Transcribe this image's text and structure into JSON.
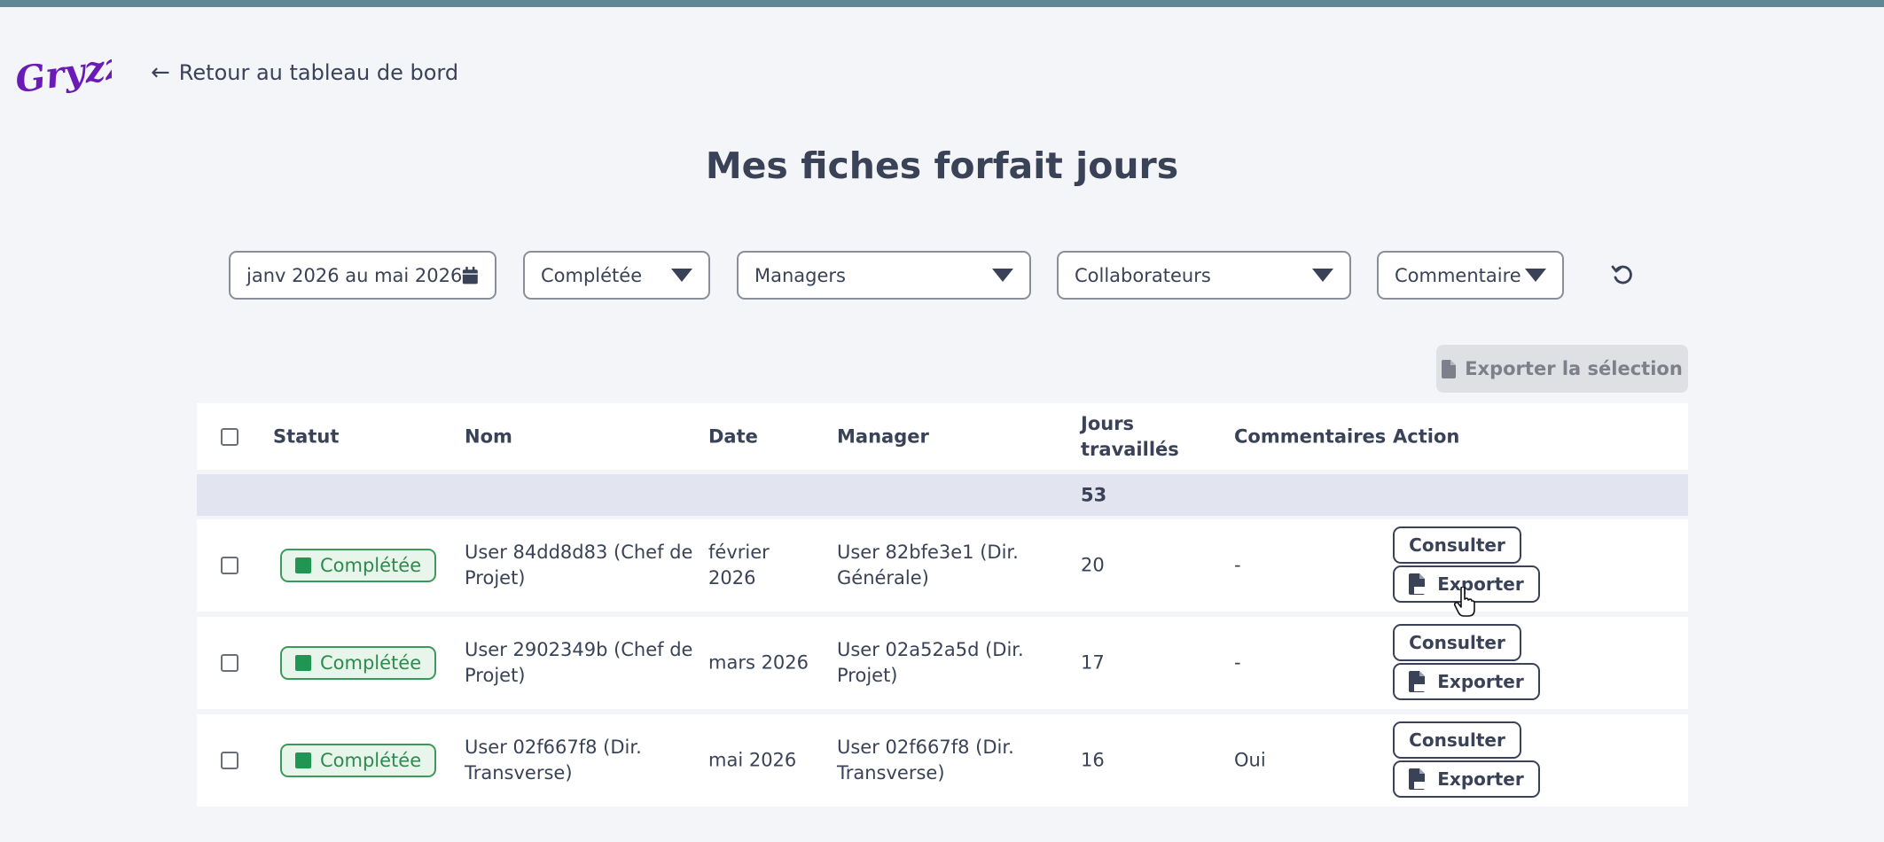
{
  "brand": {
    "logo_text": "Gryzzly",
    "logo_color": "#6b1bb5"
  },
  "nav": {
    "back_label": "Retour au tableau de bord"
  },
  "page": {
    "title": "Mes fiches forfait jours"
  },
  "filters": {
    "date_range": "janv 2026 au mai 2026",
    "status": "Complétée",
    "managers": "Managers",
    "collaborators": "Collaborateurs",
    "comment": "Commentaire"
  },
  "toolbar": {
    "export_selection": "Exporter la sélection"
  },
  "table": {
    "headers": {
      "status": "Statut",
      "name": "Nom",
      "date": "Date",
      "manager": "Manager",
      "days_line1": "Jours",
      "days_line2": "travaillés",
      "comments": "Commentaires",
      "action": "Action"
    },
    "total_days": "53",
    "rows": [
      {
        "status": "Complétée",
        "name_line1": "User 84dd8d83 (Chef de",
        "name_line2": "Projet)",
        "date_line1": "février",
        "date_line2": "2026",
        "manager_line1": "User 82bfe3e1 (Dir.",
        "manager_line2": "Générale)",
        "days": "20",
        "comment": "-"
      },
      {
        "status": "Complétée",
        "name_line1": "User 2902349b (Chef de",
        "name_line2": "Projet)",
        "date_line1": "mars 2026",
        "date_line2": "",
        "manager_line1": "User 02a52a5d (Dir.",
        "manager_line2": "Projet)",
        "days": "17",
        "comment": "-"
      },
      {
        "status": "Complétée",
        "name_line1": "User 02f667f8 (Dir.",
        "name_line2": "Transverse)",
        "date_line1": "mai 2026",
        "date_line2": "",
        "manager_line1": "User 02f667f8 (Dir.",
        "manager_line2": "Transverse)",
        "days": "16",
        "comment": "Oui"
      }
    ],
    "actions": {
      "consult": "Consulter",
      "export": "Exporter"
    }
  },
  "icons": {
    "back": "arrow-left-icon",
    "calendar": "calendar-icon",
    "reset": "reset-icon",
    "file": "file-icon",
    "pdf": "pdf-file-icon"
  },
  "colors": {
    "accent_bar": "#5f8795",
    "text": "#3a4257",
    "status_green": "#219653",
    "total_row_bg": "#e2e5f0"
  }
}
